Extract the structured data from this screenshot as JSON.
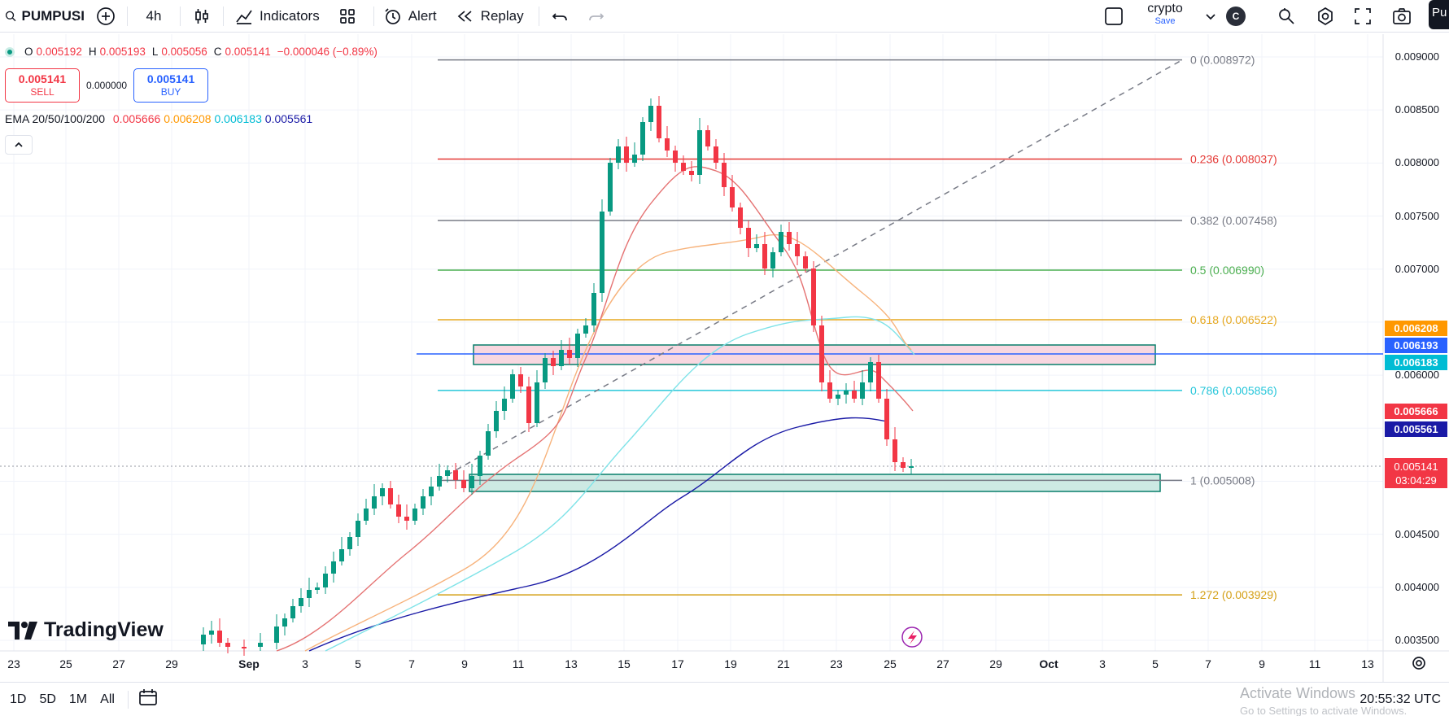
{
  "toolbar": {
    "symbol": "PUMPUSI",
    "interval": "4h",
    "indicators_label": "Indicators",
    "alert_label": "Alert",
    "replay_label": "Replay",
    "layout_name": "crypto",
    "layout_status": "Save",
    "avatar_letter": "C",
    "publish_label": "Pu"
  },
  "legend": {
    "o_key": "O",
    "o_val": "0.005192",
    "h_key": "H",
    "h_val": "0.005193",
    "l_key": "L",
    "l_val": "0.005056",
    "c_key": "C",
    "c_val": "0.005141",
    "change": "−0.000046 (−0.89%)",
    "sell_price": "0.005141",
    "sell_label": "SELL",
    "spread": "0.000000",
    "buy_price": "0.005141",
    "buy_label": "BUY",
    "ema_name": "EMA 20/50/100/200",
    "ema20": "0.005666",
    "ema50": "0.006208",
    "ema100": "0.006183",
    "ema200": "0.005561",
    "colors": {
      "ema20": "#f23645",
      "ema50": "#ff9800",
      "ema100": "#00bcd4",
      "ema200": "#1a1aa6"
    }
  },
  "price_axis": {
    "labels": [
      "0.009000",
      "0.008500",
      "0.008000",
      "0.007500",
      "0.007000",
      "0.006000",
      "0.004500",
      "0.004000",
      "0.003500"
    ],
    "tags": [
      {
        "text": "0.006208",
        "color": "#ff9800"
      },
      {
        "text": "0.006193",
        "color": "#2962ff"
      },
      {
        "text": "0.006183",
        "color": "#00bcd4"
      },
      {
        "text": "0.005666",
        "color": "#f23645"
      },
      {
        "text": "0.005561",
        "color": "#1a1aa6"
      }
    ],
    "last_price": "0.005141",
    "countdown": "03:04:29"
  },
  "time_axis": {
    "labels": [
      "23",
      "25",
      "27",
      "29",
      "Sep",
      "3",
      "5",
      "7",
      "9",
      "11",
      "13",
      "15",
      "17",
      "19",
      "21",
      "23",
      "25",
      "27",
      "29",
      "Oct",
      "3",
      "5",
      "7",
      "9",
      "11",
      "13"
    ]
  },
  "fib": [
    {
      "label": "0 (0.008972)",
      "price": 0.008972,
      "color": "#787b86"
    },
    {
      "label": "0.236 (0.008037)",
      "price": 0.008037,
      "color": "#e53935"
    },
    {
      "label": "0.382 (0.007458)",
      "price": 0.007458,
      "color": "#787b86"
    },
    {
      "label": "0.5 (0.006990)",
      "price": 0.00699,
      "color": "#4caf50"
    },
    {
      "label": "0.618 (0.006522)",
      "price": 0.006522,
      "color": "#e6a820"
    },
    {
      "label": "0.786 (0.005856)",
      "price": 0.005856,
      "color": "#26c6da"
    },
    {
      "label": "1 (0.005008)",
      "price": 0.005008,
      "color": "#787b86"
    },
    {
      "label": "1.272 (0.003929)",
      "price": 0.003929,
      "color": "#d4a017"
    }
  ],
  "bottom": {
    "ranges": [
      "1D",
      "5D",
      "1M",
      "All"
    ],
    "clock": "20:55:32 UTC",
    "watermark": "Activate Windows",
    "watermark_sub": "Go to Settings to activate Windows."
  },
  "brand": {
    "name": "TradingView"
  }
}
